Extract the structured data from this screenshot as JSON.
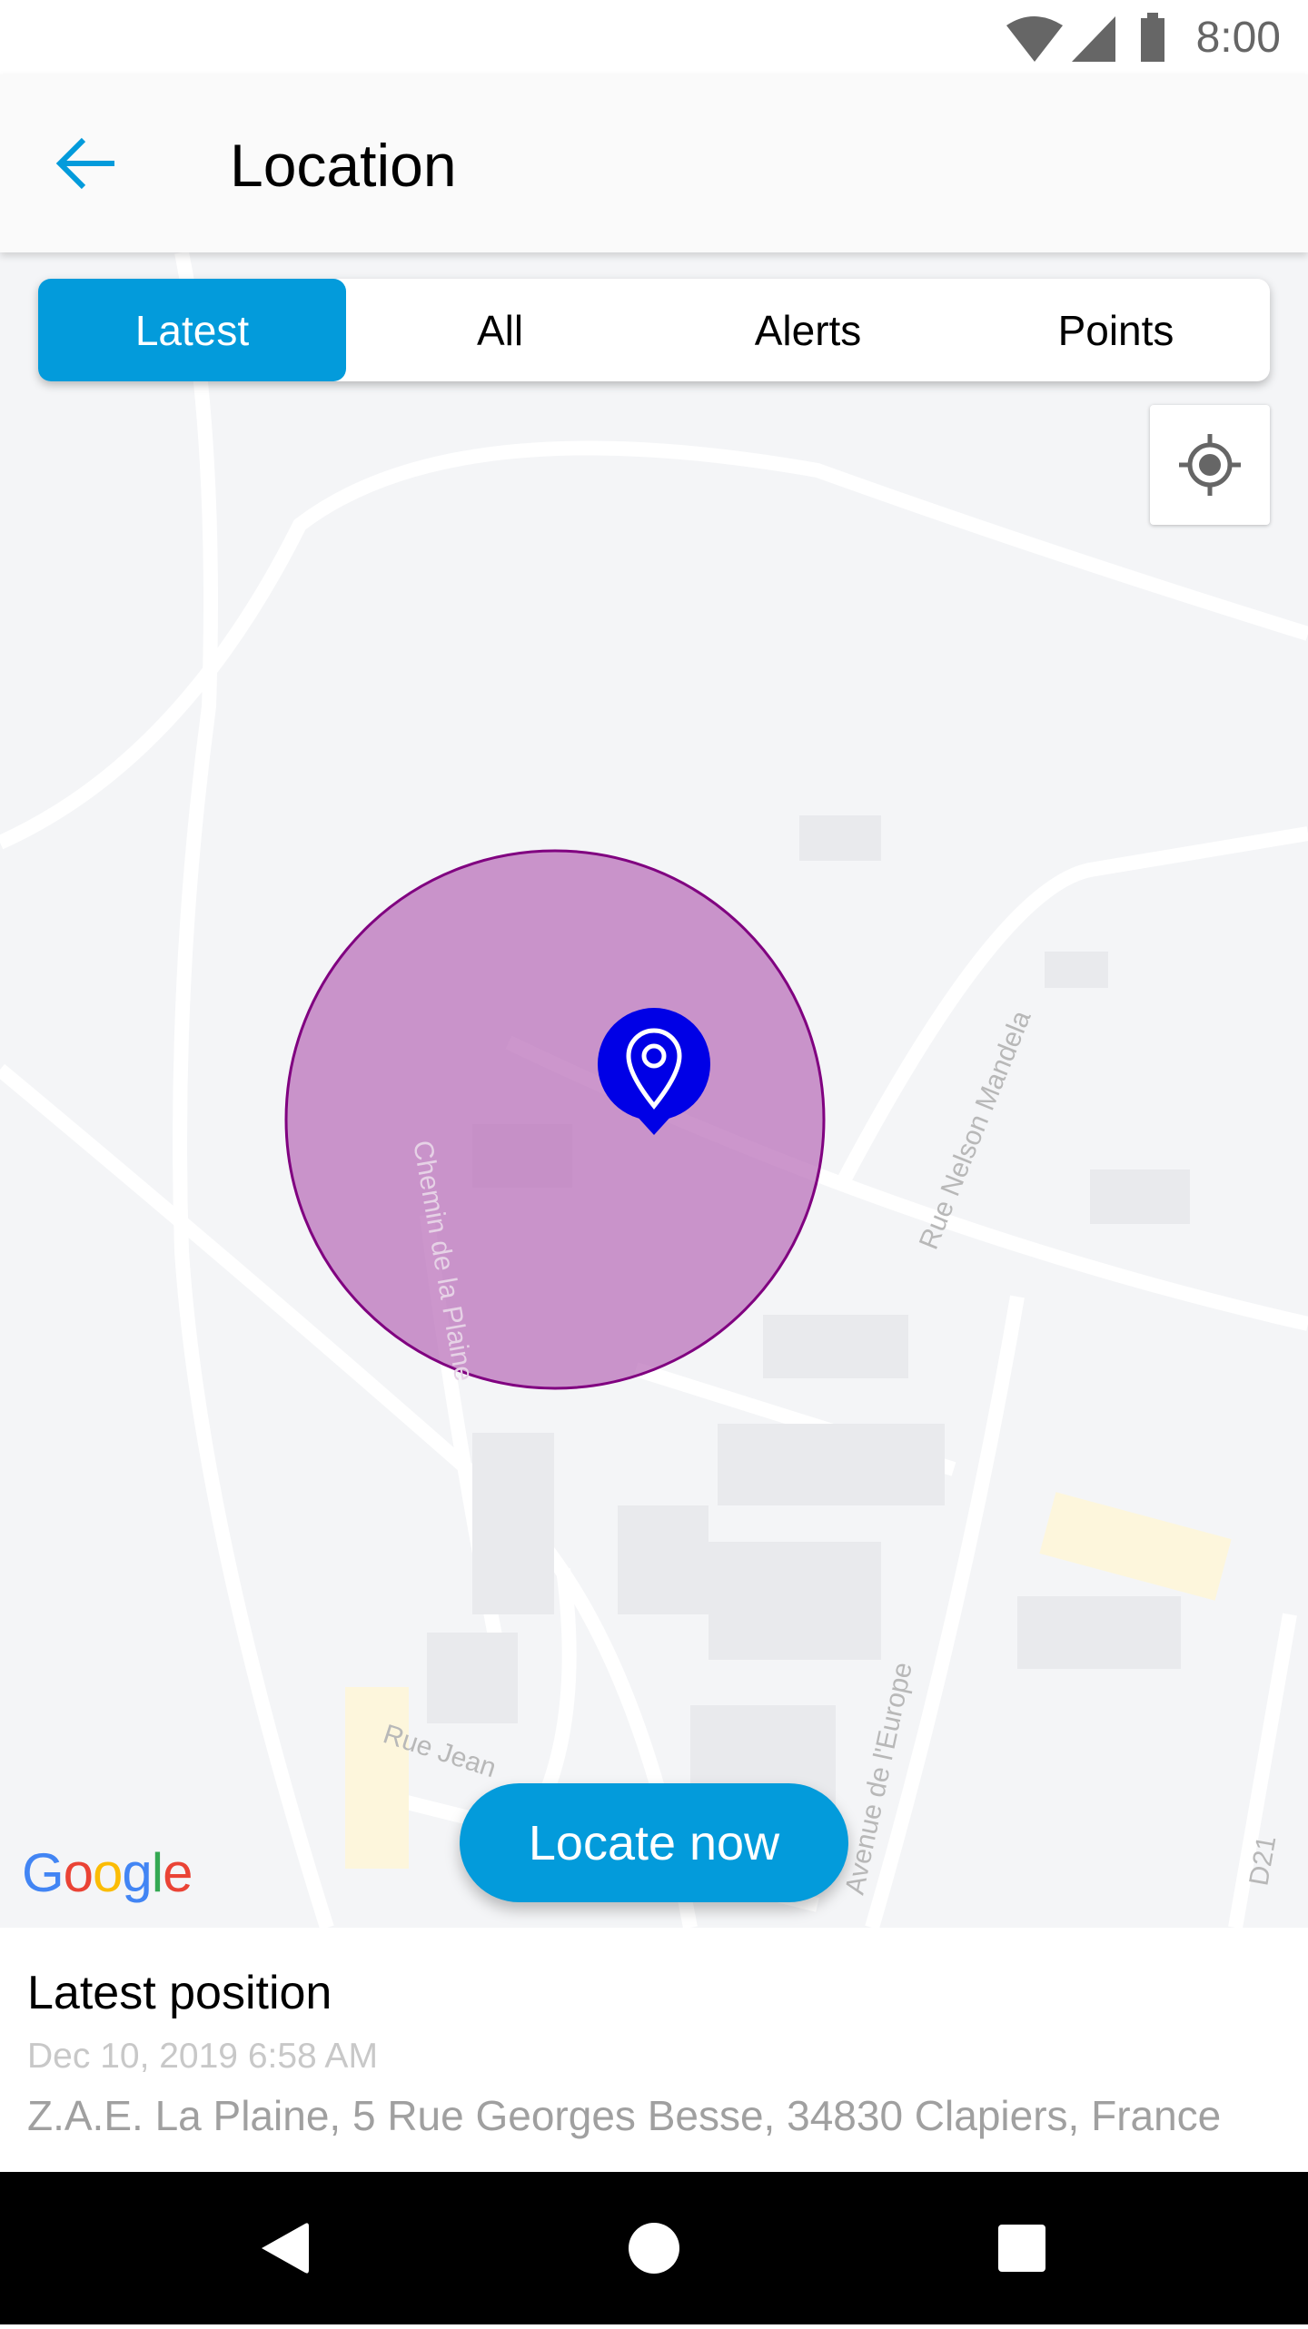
{
  "status_bar": {
    "time": "8:00",
    "icons": [
      "wifi-icon",
      "signal-icon",
      "battery-icon"
    ]
  },
  "app_bar": {
    "title": "Location",
    "back_icon": "arrow-left-icon"
  },
  "tabs": [
    {
      "label": "Latest",
      "active": true
    },
    {
      "label": "All",
      "active": false
    },
    {
      "label": "Alerts",
      "active": false
    },
    {
      "label": "Points",
      "active": false
    }
  ],
  "map": {
    "provider_logo": "Google",
    "street_labels": [
      "Chemin de la Plaine",
      "Rue Nelson Mandela",
      "Avenue de l'Europe",
      "Rue Jean",
      "D21"
    ],
    "accuracy_circle_color": "#c896c8",
    "marker_color": "#0000e6",
    "my_location_icon": "crosshair-icon"
  },
  "locate_button": {
    "label": "Locate now"
  },
  "panel": {
    "title": "Latest position",
    "date": "Dec 10, 2019 6:58 AM",
    "address": "Z.A.E. La Plaine, 5 Rue Georges Besse, 34830 Clapiers, France"
  },
  "colors": {
    "accent": "#039bdb"
  }
}
